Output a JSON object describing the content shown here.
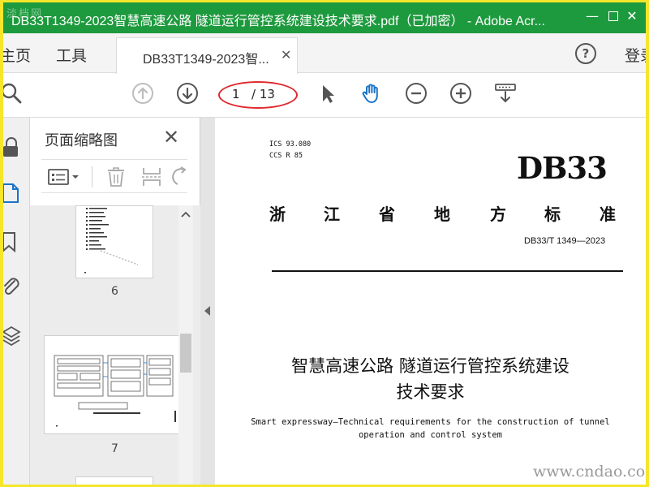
{
  "window": {
    "title": "DB33T1349-2023智慧高速公路 隧道运行管控系统建设技术要求.pdf（已加密） - Adobe Acr...",
    "watermark_logo": "淡档网",
    "controls": {
      "minimize": "—",
      "close": "✕"
    }
  },
  "tabs": {
    "home": "主页",
    "tools": "工具",
    "document": "DB33T1349-2023智...",
    "document_close": "✕",
    "help": "?",
    "login": "登录"
  },
  "toolbar": {
    "page_current": "1",
    "page_total": "/ 13",
    "icons": [
      "search-icon",
      "prev-page-icon",
      "next-page-icon",
      "select-cursor-icon",
      "hand-tool-icon",
      "zoom-out-icon",
      "zoom-in-icon",
      "fit-page-icon"
    ],
    "accent_color": "#1a73c8",
    "highlight_color": "#e0282e"
  },
  "left_rail": {
    "icons": [
      "lock-icon",
      "page-thumbnails-icon",
      "bookmark-icon",
      "attachment-icon",
      "layers-icon"
    ]
  },
  "thumbnails_panel": {
    "title": "页面缩略图",
    "close": "✕",
    "tools": [
      "thumbnail-options-icon",
      "delete-page-icon",
      "extract-page-icon",
      "rotate-page-icon"
    ],
    "pages": [
      {
        "number": "6"
      },
      {
        "number": "7"
      }
    ]
  },
  "document": {
    "ics": "ICS  93.080",
    "ccs": "CCS  R 85",
    "logo": "DB33",
    "province_chars": [
      "浙",
      "江",
      "省",
      "地",
      "方",
      "标",
      "准"
    ],
    "standard_number": "DB33/T 1349—2023",
    "title_cn_line1": "智慧高速公路 隧道运行管控系统建设",
    "title_cn_line2": "技术要求",
    "title_en_line1": "Smart expressway—Technical requirements for the construction of tunnel",
    "title_en_line2": "operation and control system"
  },
  "site_watermark": "www.cndao.com",
  "colors": {
    "titlebar_bg": "#1e9a3e",
    "outer_border": "#f5e62a"
  }
}
